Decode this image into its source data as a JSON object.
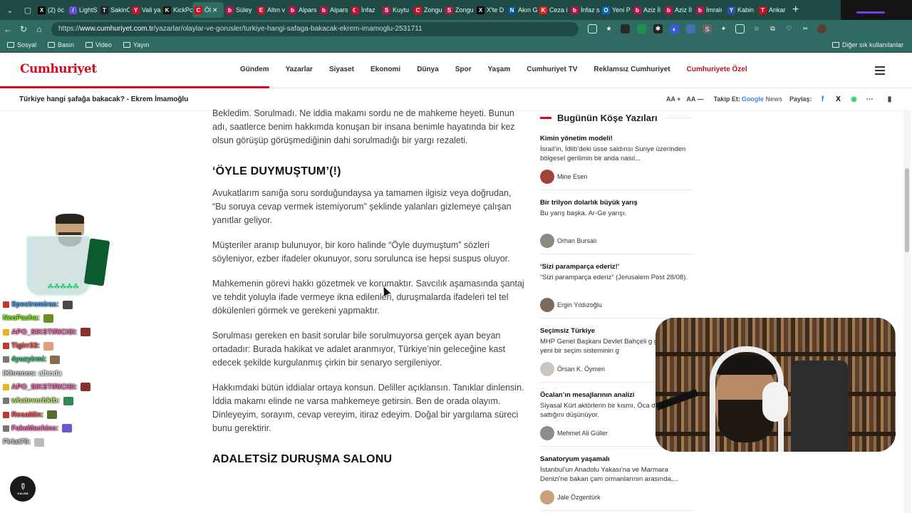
{
  "browser": {
    "tabs": [
      {
        "label": "(2) öc",
        "color": "#000000",
        "glyph": "X"
      },
      {
        "label": "LightS",
        "color": "#6b4bd8",
        "glyph": "/"
      },
      {
        "label": "SakinC",
        "color": "#222222",
        "glyph": "T"
      },
      {
        "label": "Vali ya",
        "color": "#c8102e",
        "glyph": "Y"
      },
      {
        "label": "KickPc",
        "color": "#111111",
        "glyph": "K"
      },
      {
        "label": "Öl",
        "color": "#d50a1f",
        "glyph": "C",
        "active": true
      },
      {
        "label": "Süley",
        "color": "#b5124a",
        "glyph": "b"
      },
      {
        "label": "Altın v",
        "color": "#c8102e",
        "glyph": "E"
      },
      {
        "label": "Alpars",
        "color": "#b5124a",
        "glyph": "b"
      },
      {
        "label": "Alpars",
        "color": "#b5124a",
        "glyph": "b"
      },
      {
        "label": "İnfaz",
        "color": "#c8102e",
        "glyph": "☾"
      },
      {
        "label": "Kuytu",
        "color": "#b31942",
        "glyph": "S"
      },
      {
        "label": "Zongu",
        "color": "#d50a1f",
        "glyph": "C"
      },
      {
        "label": "Zongu",
        "color": "#b31942",
        "glyph": "S"
      },
      {
        "label": "X'te D",
        "color": "#000000",
        "glyph": "X"
      },
      {
        "label": "Akın G",
        "color": "#0b5394",
        "glyph": "N"
      },
      {
        "label": "Ceza i",
        "color": "#e32119",
        "glyph": "K"
      },
      {
        "label": "İnfaz s",
        "color": "#b5124a",
        "glyph": "b"
      },
      {
        "label": "Yeni P",
        "color": "#0a66c2",
        "glyph": "O"
      },
      {
        "label": "Aziz İl",
        "color": "#b5124a",
        "glyph": "b"
      },
      {
        "label": "Aziz İl",
        "color": "#b5124a",
        "glyph": "b"
      },
      {
        "label": "İmralı",
        "color": "#b5124a",
        "glyph": "b"
      },
      {
        "label": "Kabin",
        "color": "#2255aa",
        "glyph": "Y"
      },
      {
        "label": "Ankar",
        "color": "#d50a1f",
        "glyph": "T"
      }
    ],
    "url_prefix": "https://",
    "url_host": "www.cumhuriyet.com.tr",
    "url_path": "/yazarlar/olaylar-ve-gorusler/turkiye-hangi-safaga-bakacak-ekrem-imamoglu-2531711",
    "bookmarks": [
      "Sosyal",
      "Basın",
      "Video",
      "Yayın"
    ],
    "bookmarks_right": "Diğer sık kullanılanlar"
  },
  "site": {
    "logo": "Cumhuriyet",
    "nav": [
      "Gündem",
      "Yazarlar",
      "Siyaset",
      "Ekonomi",
      "Dünya",
      "Spor",
      "Yaşam",
      "Cumhuriyet TV",
      "Reklamsız Cumhuriyet"
    ],
    "nav_special": "Cumhuriyete Özel"
  },
  "titlebar": {
    "title": "Türkiye hangi şafağa bakacak? - Ekrem İmamoğlu",
    "font_up": "AA +",
    "font_down": "AA —",
    "follow_label": "Takip Et:",
    "gnews_google": "Google",
    "gnews_news": "News",
    "share_label": "Paylaş:"
  },
  "article": {
    "p0": "Bekledim. Sorulmadı. Ne iddia makamı sordu ne de mahkeme heyeti. Bunun adı, saatlerce benim hakkımda konuşan bir insana benimle hayatında bir kez olsun görüşüp görüşmediğinin dahi sorulmadığı bir yargı rezaleti.",
    "h1": "‘ÖYLE DUYMUŞTUM’(!)",
    "p1": "Avukatlarım sanığa soru sorduğundaysa ya tamamen ilgisiz veya doğrudan, “Bu soruya cevap vermek istemiyorum” şeklinde yalanları gizlemeye çalışan yanıtlar geliyor.",
    "p2": "Müşteriler aranıp bulunuyor, bir koro halinde “Öyle duymuştum” sözleri söyleniyor, ezber ifadeler okunuyor, soru sorulunca ise hepsi suspus oluyor.",
    "p3": "Mahkemenin görevi hakkı gözetmek ve korumaktır. Savcılık aşamasında şantaj ve tehdit yoluyla ifade vermeye ikna edilenleri, duruşmalarda ifadeleri tel tel dökülenleri görmek ve gerekeni yapmaktır.",
    "p4": "Sorulması gereken en basit sorular bile sorulmuyorsa gerçek ayan beyan ortadadır: Burada hakikat ve adalet aranmıyor, Türkiye’nin geleceğine kast edecek şekilde kurgulanmış çirkin bir senaryo sergileniyor.",
    "p5": "Hakkımdaki bütün iddialar ortaya konsun. Deliller açıklansın. Tanıklar dinlensin. İddia makamı elinde ne varsa mahkemeye getirsin. Ben de orada olayım. Dinleyeyim, sorayım, cevap vereyim, itiraz edeyim. Doğal bir yargılama süreci bunu gerektirir.",
    "h2": "ADALETSİZ DURUŞMA SALONU"
  },
  "sidebar": {
    "heading": "Bugünün Köşe Yazıları",
    "columns": [
      {
        "title": "Kimin yönetim modeli!",
        "summary": "İsrail’in, İdlib’deki üsse saldırısı Suriye üzerinden bölgesel gerilimin bir anda nasıl...",
        "author": "Mine Esen",
        "avatar_color": "#a0453a"
      },
      {
        "title": "Bir trilyon dolarlık büyük yarış",
        "summary": "Bu yarış başka. Ar-Ge yarışı.",
        "author": "Orhan Bursalı",
        "avatar_color": "#8a8a80"
      },
      {
        "title": "‘Sizi paramparça ederiz!’",
        "summary": "“Sizi paramparça ederiz” (Jerusalem Post 28/08).",
        "author": "Ergin Yıldızoğlu",
        "avatar_color": "#7a6a60"
      },
      {
        "title": "Seçimsiz Türkiye",
        "summary": "MHP Genel Başkanı Devlet Bahçeli g günlerde yeni bir seçim sisteminin g",
        "author": "Örsan K. Öymen",
        "avatar_color": "#c9c4bf"
      },
      {
        "title": "Öcalan’ın mesajlarının analizi",
        "summary": "Siyasal Kürt aktörlerin bir kısmı, Öca davasını” sattığını düşünüyor.",
        "author": "Mehmet Ali Güller",
        "avatar_color": "#8d8d8d"
      },
      {
        "title": "Sanatoryum yaşamalı",
        "summary": "İstanbul’un Anadolu Yakası’na ve Marmara Denizi’ne bakan çam ormanlarının arasında,...",
        "author": "Jale Özgentürk",
        "avatar_color": "#c7a27c"
      }
    ]
  },
  "chat": [
    {
      "name": "Spectremiras:",
      "name_color": "#3aa0ff",
      "badge": "#c0392b",
      "msg": "",
      "emote": "#4a4a4a"
    },
    {
      "name": "NeoPasha:",
      "name_color": "#7cfc00",
      "badge": "",
      "msg": "",
      "emote": "#6b8e23"
    },
    {
      "name": "APO_SIKSTIRICISI:",
      "name_color": "#ff69b4",
      "badge": "#e6b422",
      "msg": "",
      "emote": "#8b2e2e"
    },
    {
      "name": "Tigirr33:",
      "name_color": "#ff4d4d",
      "badge": "#c0392b",
      "msg": "",
      "emote": "#e0a080"
    },
    {
      "name": "4yuzyirmi:",
      "name_color": "#2ecc71",
      "badge": "#777777",
      "msg": "",
      "emote": "#8a6a50"
    },
    {
      "name": "IKhronos:",
      "name_color": "#dddddd",
      "badge": "",
      "msg": "altında",
      "emote": ""
    },
    {
      "name": "APO_SIKSTIRICISI:",
      "name_color": "#ff69b4",
      "badge": "#e6b422",
      "msg": "",
      "emote": "#8b2e2e"
    },
    {
      "name": "whateverbktb:",
      "name_color": "#c8f060",
      "badge": "#777777",
      "msg": "",
      "emote": "#2e8b57"
    },
    {
      "name": "RosaMin:",
      "name_color": "#ff5a5a",
      "badge": "#c0392b",
      "msg": "",
      "emote": "#556b2f"
    },
    {
      "name": "FakeMachine:",
      "name_color": "#ff69b4",
      "badge": "#777777",
      "msg": "",
      "emote": "#6a5acd"
    },
    {
      "name": "Firiat75:",
      "name_color": "#cfcfcf",
      "badge": "",
      "msg": "",
      "emote": "#bbbbbb"
    }
  ],
  "fab_label": "KALEM"
}
